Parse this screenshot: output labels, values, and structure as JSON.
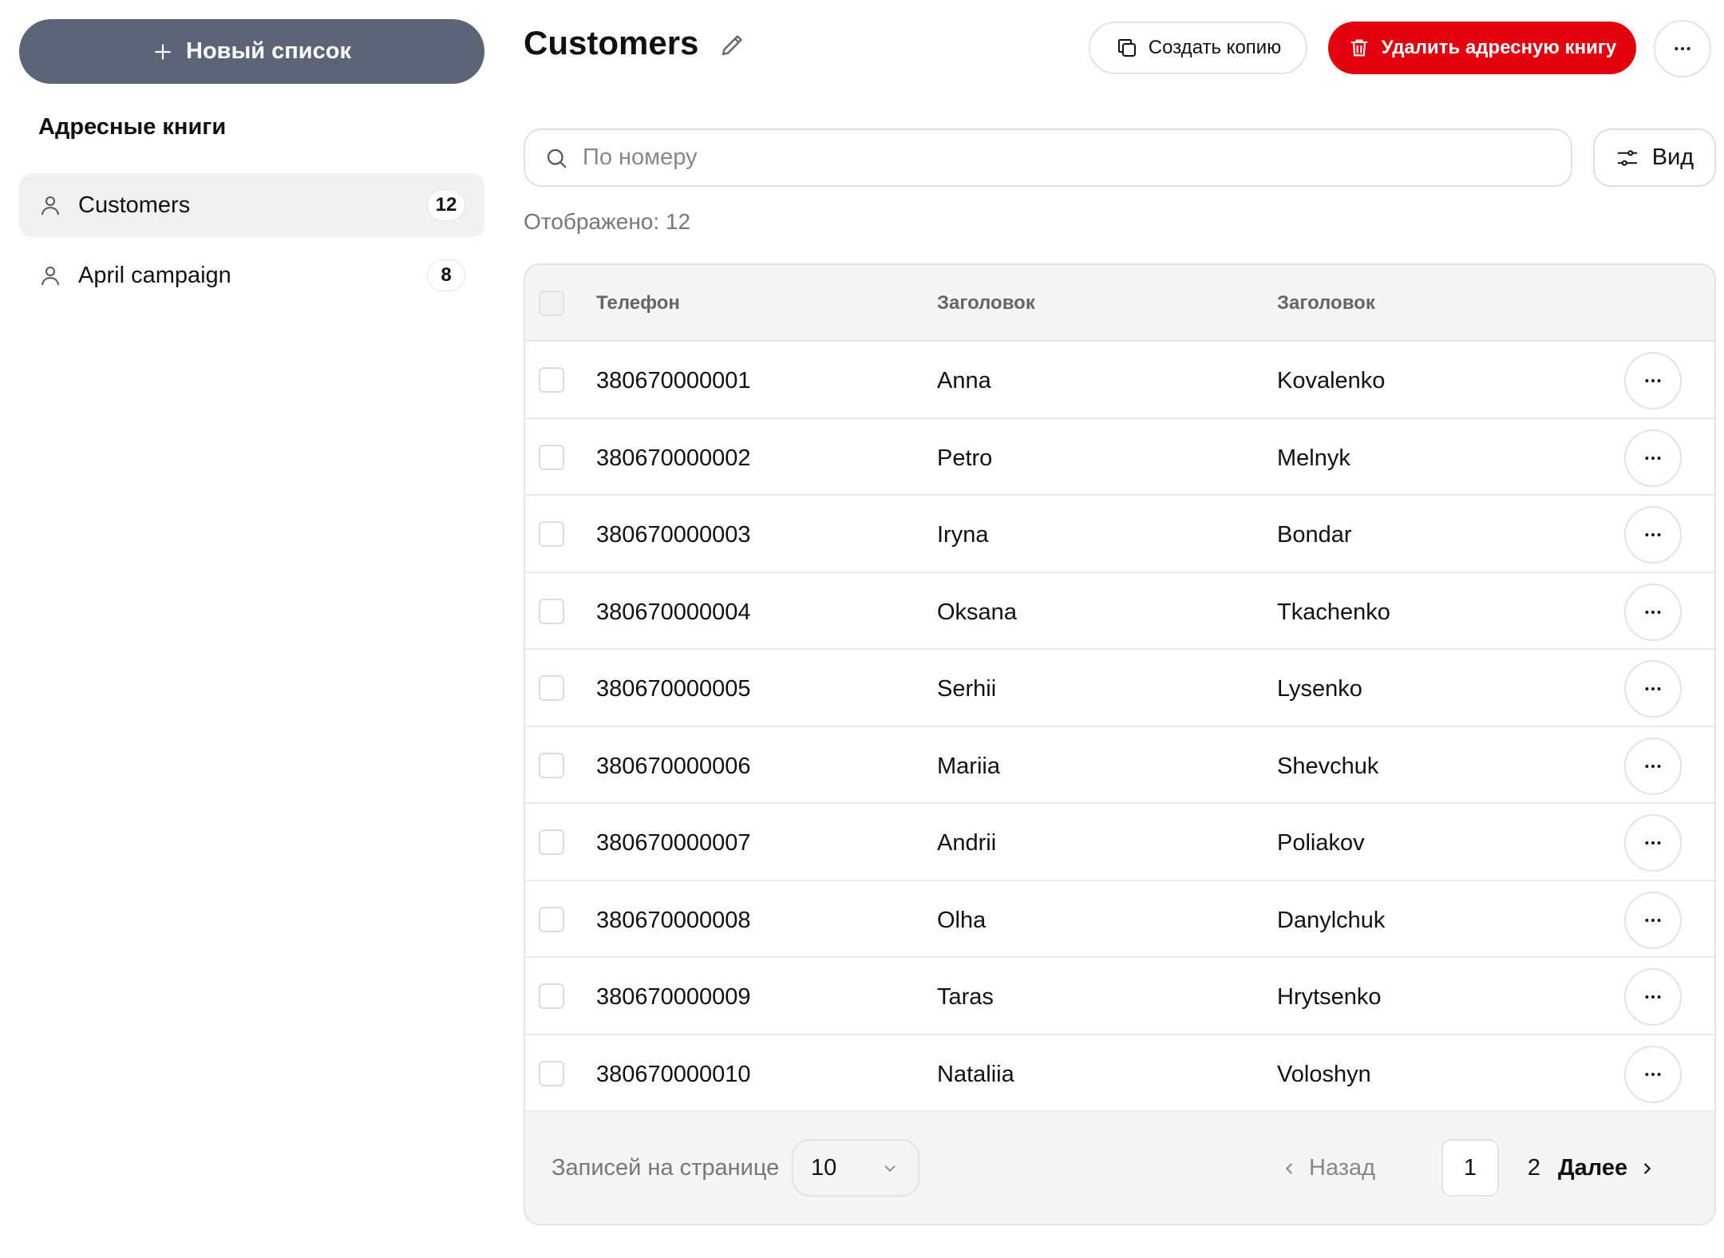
{
  "sidebar": {
    "new_list_label": "Новый список",
    "section_title": "Адресные книги",
    "books": [
      {
        "name": "Customers",
        "count": "12"
      },
      {
        "name": "April campaign",
        "count": "8"
      }
    ]
  },
  "header": {
    "title": "Customers",
    "copy_label": "Создать копию",
    "delete_label": "Удалить адресную книгу"
  },
  "search": {
    "placeholder": "По номеру",
    "value": ""
  },
  "view_label": "Вид",
  "shown_count": "Отображено: 12",
  "table": {
    "headers": [
      "Телефон",
      "Заголовок",
      "Заголовок"
    ],
    "rows": [
      {
        "phone": "380670000001",
        "first": "Anna",
        "last": "Kovalenko"
      },
      {
        "phone": "380670000002",
        "first": "Petro",
        "last": "Melnyk"
      },
      {
        "phone": "380670000003",
        "first": "Iryna",
        "last": "Bondar"
      },
      {
        "phone": "380670000004",
        "first": "Oksana",
        "last": "Tkachenko"
      },
      {
        "phone": "380670000005",
        "first": "Serhii",
        "last": "Lysenko"
      },
      {
        "phone": "380670000006",
        "first": "Mariia",
        "last": "Shevchuk"
      },
      {
        "phone": "380670000007",
        "first": "Andrii",
        "last": "Poliakov"
      },
      {
        "phone": "380670000008",
        "first": "Olha",
        "last": "Danylchuk"
      },
      {
        "phone": "380670000009",
        "first": "Taras",
        "last": "Hrytsenko"
      },
      {
        "phone": "380670000010",
        "first": "Nataliia",
        "last": "Voloshyn"
      }
    ]
  },
  "footer": {
    "per_page_label": "Записей на странице",
    "per_page_value": "10",
    "prev_label": "Назад",
    "pages": [
      "1",
      "2"
    ],
    "current_page": "1",
    "next_label": "Далее"
  },
  "colors": {
    "accent_dark": "#5b6577",
    "danger": "#e3000f"
  }
}
